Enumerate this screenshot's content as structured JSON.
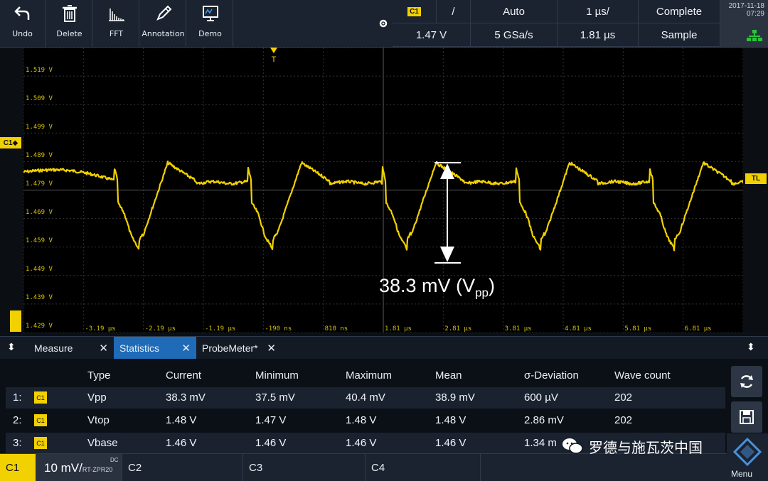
{
  "toolbar": {
    "tools": [
      {
        "label": "Undo",
        "icon": "undo-icon"
      },
      {
        "label": "Delete",
        "icon": "trash-icon"
      },
      {
        "label": "FFT",
        "icon": "fft-icon"
      },
      {
        "label": "Annotation",
        "icon": "pen-icon"
      },
      {
        "label": "Demo",
        "icon": "demo-icon"
      }
    ],
    "trigger": {
      "channel": "C1",
      "slope": "/",
      "mode": "Auto",
      "timebase": "1 µs/",
      "acq_state": "Complete",
      "level": "1.47 V",
      "sample_rate": "5 GSa/s",
      "position": "1.81 µs",
      "acq_mode": "Sample"
    },
    "date": "2017-11-18",
    "time": "07:29"
  },
  "plot": {
    "y_labels": [
      "1.519 V",
      "1.509 V",
      "1.499 V",
      "1.489 V",
      "1.479 V",
      "1.469 V",
      "1.459 V",
      "1.449 V",
      "1.439 V",
      "1.429 V"
    ],
    "x_labels": [
      "-3.19 µs",
      "-2.19 µs",
      "-1.19 µs",
      "-190 ns",
      "810 ns",
      "1.81 µs",
      "2.81 µs",
      "3.81 µs",
      "4.81 µs",
      "5.81 µs",
      "6.81 µs"
    ],
    "trigger_marker": "T",
    "channel_marker": "C1",
    "trigger_level_marker": "TL",
    "measurement_value": "38.3 mV",
    "measurement_open": "(V",
    "measurement_sub": "pp",
    "measurement_close": ")",
    "trace_color": "#f2d100"
  },
  "tabs": [
    {
      "label": "Measure",
      "close": "✕"
    },
    {
      "label": "Statistics",
      "close": "✕"
    },
    {
      "label": "ProbeMeter*",
      "close": "✕"
    }
  ],
  "stats": {
    "headers": [
      "Type",
      "Current",
      "Minimum",
      "Maximum",
      "Mean",
      "σ-Deviation",
      "Wave count"
    ],
    "rows": [
      {
        "idx": "1:",
        "ch": "C1",
        "type": "Vpp",
        "current": "38.3 mV",
        "min": "37.5 mV",
        "max": "40.4 mV",
        "mean": "38.9 mV",
        "sdev": "600 µV",
        "count": "202"
      },
      {
        "idx": "2:",
        "ch": "C1",
        "type": "Vtop",
        "current": "1.48 V",
        "min": "1.47 V",
        "max": "1.48 V",
        "mean": "1.48 V",
        "sdev": "2.86 mV",
        "count": "202"
      },
      {
        "idx": "3:",
        "ch": "C1",
        "type": "Vbase",
        "current": "1.46 V",
        "min": "1.46 V",
        "max": "1.46 V",
        "mean": "1.46 V",
        "sdev": "1.34 m",
        "count": ""
      }
    ]
  },
  "channels": {
    "c1": {
      "name": "C1",
      "scale": "10 mV/",
      "probe": "RT-ZPR20",
      "coupling": "DC"
    },
    "c2": {
      "name": "C2"
    },
    "c3": {
      "name": "C3"
    },
    "c4": {
      "name": "C4"
    }
  },
  "menu_label": "Menu",
  "watermark": "罗德与施瓦茨中国"
}
